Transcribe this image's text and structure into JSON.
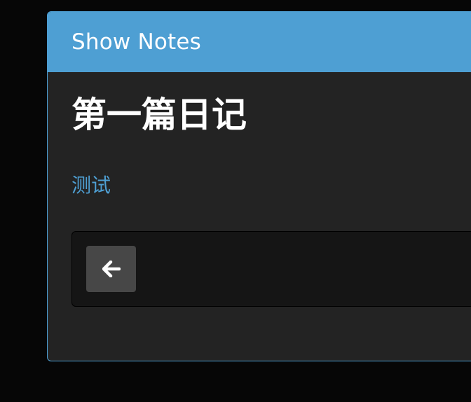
{
  "panel": {
    "header_title": "Show Notes"
  },
  "note": {
    "title": "第一篇日记",
    "tag": "测试"
  },
  "toolbar": {
    "back_icon": "arrow-left-icon"
  },
  "colors": {
    "accent": "#4e9fd3",
    "panel_bg": "#232323",
    "page_bg": "#060606",
    "well_bg": "#151515",
    "button_bg": "#474747"
  }
}
